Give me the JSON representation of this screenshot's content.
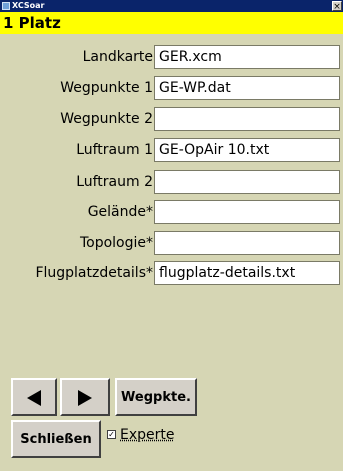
{
  "window": {
    "title": "XCSoar",
    "close_glyph": "×"
  },
  "page": {
    "heading": "1 Platz"
  },
  "files": [
    {
      "label": "Landkarte",
      "value": "GER.xcm"
    },
    {
      "label": "Wegpunkte 1",
      "value": "GE-WP.dat"
    },
    {
      "label": "Wegpunkte 2",
      "value": ""
    },
    {
      "label": "Luftraum 1",
      "value": "GE-OpAir 10.txt"
    },
    {
      "label": "Luftraum 2",
      "value": ""
    },
    {
      "label": "Gelände*",
      "value": ""
    },
    {
      "label": "Topologie*",
      "value": ""
    },
    {
      "label": "Flugplatzdetails*",
      "value": "flugplatz-details.txt"
    }
  ],
  "buttons": {
    "prev_icon": "triangle-left-icon",
    "next_icon": "triangle-right-icon",
    "waypoints_label": "Wegpkte.",
    "close_label": "Schließen"
  },
  "expert": {
    "label": "Experte",
    "checked": true,
    "check_glyph": "✓"
  },
  "colors": {
    "background": "#d6d6b4",
    "header": "#ffff00",
    "titlebar": "#0a246a"
  }
}
